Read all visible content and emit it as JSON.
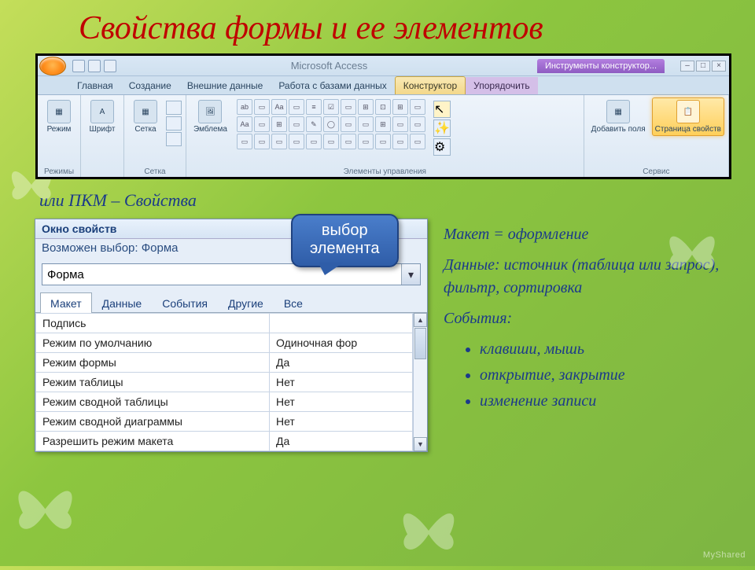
{
  "slide_title": "Свойства формы и ее элементов",
  "ribbon": {
    "app_title": "Microsoft Access",
    "tool_context": "Инструменты конструктор...",
    "tabs": {
      "home": "Главная",
      "create": "Создание",
      "external": "Внешние данные",
      "database": "Работа с базами данных",
      "designer": "Конструктор",
      "arrange": "Упорядочить"
    },
    "groups": {
      "modes": "Режимы",
      "mode_btn": "Режим",
      "font_btn": "Шрифт",
      "grid_btn": "Сетка",
      "grid": "Сетка",
      "emblem_btn": "Эмблема",
      "controls": "Элементы управления",
      "addfields_btn": "Добавить поля",
      "propsheet_btn": "Страница свойств",
      "service": "Сервис"
    }
  },
  "note_text": "или ПКМ – Свойства",
  "callout": {
    "line1": "выбор",
    "line2": "элемента"
  },
  "prop": {
    "title": "Окно свойств",
    "subtitle": "Возможен выбор: Форма",
    "combo_value": "Форма",
    "tabs": {
      "layout": "Макет",
      "data": "Данные",
      "events": "События",
      "other": "Другие",
      "all": "Все"
    },
    "rows": [
      {
        "name": "Подпись",
        "value": ""
      },
      {
        "name": "Режим по умолчанию",
        "value": "Одиночная фор"
      },
      {
        "name": "Режим формы",
        "value": "Да"
      },
      {
        "name": "Режим таблицы",
        "value": "Нет"
      },
      {
        "name": "Режим сводной таблицы",
        "value": "Нет"
      },
      {
        "name": "Режим сводной диаграммы",
        "value": "Нет"
      },
      {
        "name": "Разрешить режим макета",
        "value": "Да"
      }
    ]
  },
  "explain": {
    "p1a": "Макет",
    "p1b": " = оформление",
    "p2a": "Данные: ",
    "p2b": "источник (таблица или запрос), фильтр, сортировка",
    "p3a": "События:",
    "li1": "клавиши, мышь",
    "li2": "открытие, закрытие",
    "li3": "изменение записи"
  },
  "watermark": "MyShared"
}
